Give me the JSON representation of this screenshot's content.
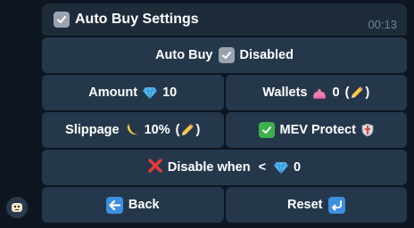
{
  "message": {
    "title": "Auto Buy Settings",
    "time": "00:13"
  },
  "keyboard": {
    "auto_buy": {
      "label": "Auto Buy",
      "status": "Disabled"
    },
    "amount": {
      "label": "Amount",
      "value": "10"
    },
    "wallets": {
      "label": "Wallets",
      "value": "0",
      "open_paren": "(",
      "close_paren": ")"
    },
    "slippage": {
      "label": "Slippage",
      "value": "10%",
      "open_paren": "(",
      "close_paren": ")"
    },
    "mev_protect": {
      "label": "MEV Protect"
    },
    "disable_when": {
      "label": "Disable when",
      "operator": "<",
      "value": "0"
    },
    "back": {
      "label": "Back"
    },
    "reset": {
      "label": "Reset"
    }
  },
  "icons": {
    "avatar": "bot-avatar-icon",
    "check": "checkbox-icon",
    "diamond": "diamond-icon",
    "wallet": "pink-blob-icon",
    "pencil": "pencil-icon",
    "banana": "banana-icon",
    "green_check": "green-check-icon",
    "shield": "shield-icon",
    "red_x": "red-cross-icon",
    "back_arrow": "left-arrow-icon",
    "reset_arrow": "return-arrow-icon"
  },
  "colors": {
    "background": "#0e1621",
    "message_bg": "#1e2c3a",
    "button_bg": "#25384b",
    "time": "#6d8397"
  }
}
